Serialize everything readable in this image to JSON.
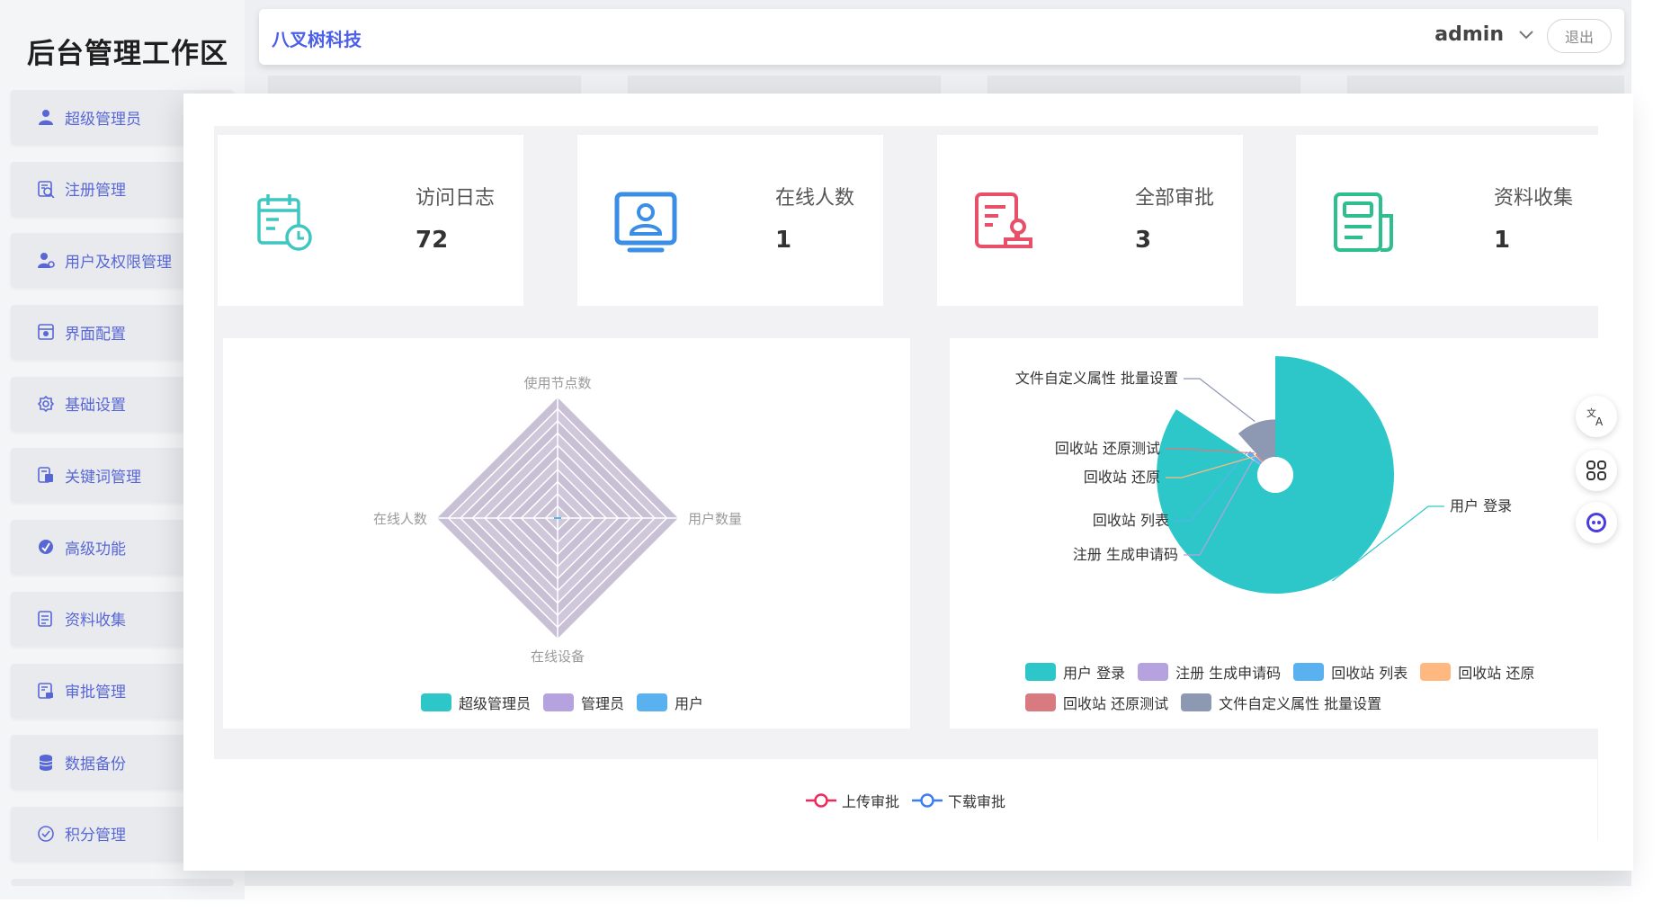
{
  "brand": "后台管理工作区",
  "company": "八叉树科技",
  "user": {
    "name": "admin",
    "logout": "退出"
  },
  "menu": [
    {
      "label": "超级管理员",
      "icon": "user-icon"
    },
    {
      "label": "注册管理",
      "icon": "register-icon"
    },
    {
      "label": "用户及权限管理",
      "icon": "user-permission-icon"
    },
    {
      "label": "界面配置",
      "icon": "layout-icon"
    },
    {
      "label": "基础设置",
      "icon": "gear-icon"
    },
    {
      "label": "关键词管理",
      "icon": "keyword-icon"
    },
    {
      "label": "高级功能",
      "icon": "advanced-icon"
    },
    {
      "label": "资料收集",
      "icon": "document-icon"
    },
    {
      "label": "审批管理",
      "icon": "approval-icon"
    },
    {
      "label": "数据备份",
      "icon": "database-icon"
    },
    {
      "label": "积分管理",
      "icon": "points-icon"
    }
  ],
  "stats": [
    {
      "label": "访问日志",
      "value": "72",
      "icon": "calendar-clock-icon",
      "color": "#3ec6c0"
    },
    {
      "label": "在线人数",
      "value": "1",
      "icon": "monitor-user-icon",
      "color": "#3a8ee6"
    },
    {
      "label": "全部审批",
      "value": "3",
      "icon": "approval-stamp-icon",
      "color": "#e8506a"
    },
    {
      "label": "资料收集",
      "value": "1",
      "icon": "newspaper-icon",
      "color": "#2fbf8f"
    }
  ],
  "chart_data": [
    {
      "type": "radar",
      "indicators": [
        "使用节点数",
        "用户数量",
        "在线设备",
        "在线人数"
      ],
      "series": [
        {
          "name": "超级管理员",
          "values": [
            0,
            0,
            0,
            0
          ]
        },
        {
          "name": "管理员",
          "values": [
            0,
            0,
            0,
            0
          ]
        },
        {
          "name": "用户",
          "values": [
            0,
            0,
            0,
            0
          ]
        }
      ],
      "colors": [
        "#2ec7c9",
        "#b6a2de",
        "#5ab1ef"
      ],
      "legend": "bottom"
    },
    {
      "type": "pie",
      "categories": [
        "用户 登录",
        "注册 生成申请码",
        "回收站 列表",
        "回收站 还原",
        "回收站 还原测试",
        "文件自定义属性 批量设置"
      ],
      "values": [
        58,
        0.3,
        1.6,
        0.3,
        0.6,
        8
      ],
      "colors": [
        "#2ec7c9",
        "#b6a2de",
        "#5ab1ef",
        "#ffb980",
        "#d87a80",
        "#8d98b3"
      ],
      "legend": "bottom"
    },
    {
      "type": "line",
      "series": [
        {
          "name": "上传审批"
        },
        {
          "name": "下载审批"
        }
      ],
      "colors": [
        "#f0295c",
        "#3a7ef0"
      ],
      "legend": "top"
    }
  ],
  "side_tools": [
    {
      "icon": "translate-icon"
    },
    {
      "icon": "grid-icon"
    },
    {
      "icon": "assistant-icon"
    }
  ]
}
